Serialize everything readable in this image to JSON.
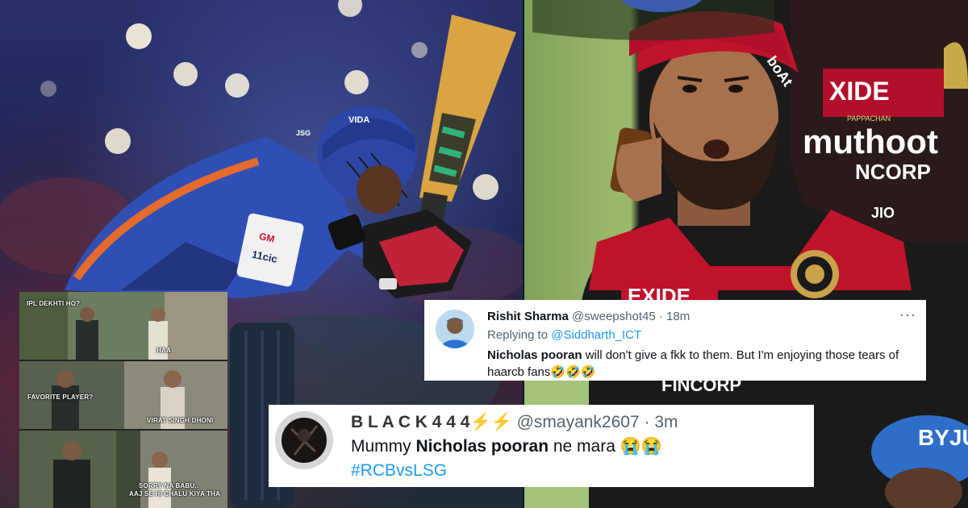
{
  "memes": [
    {
      "captions": [
        "IPL DEKHTI HO?",
        "HAA"
      ]
    },
    {
      "captions": [
        "FAVORITE PLAYER?",
        "VIRAT SINGH DHONI"
      ]
    },
    {
      "captions": [
        "SORRY NA BABU..",
        "AAJ SE HI CHALU KIYA THA"
      ]
    }
  ],
  "tweet_1": {
    "name": "Rishit Sharma",
    "handle": "@sweepshot45",
    "separator": "·",
    "time": "18m",
    "replying_prefix": "Replying to",
    "replying_to": "@Siddharth_ICT",
    "text_bold": "Nicholas pooran",
    "text_rest": " will don't give a fkk to them. But I'm enjoying those tears of haarcb fans🤣🤣🤣",
    "more": "···"
  },
  "tweet_2": {
    "name": "B L A C K 4 4 4",
    "name_emoji": "⚡⚡",
    "handle": "@smayank2607",
    "separator": "·",
    "time": "3m",
    "text_prefix": "Mummy ",
    "text_bold": "Nicholas pooran",
    "text_suffix": " ne mara 😭😭",
    "hashtag": "#RCBvsLSG"
  },
  "photo_text": {
    "left_helmet": "VIDA",
    "left_sponsor_1": "GM",
    "left_sponsor_2": "11cic",
    "left_helmet_badge": "JSG",
    "right_cap": "boAt",
    "right_exide": "XIDE",
    "right_muthoot": "muthoot",
    "right_pappachan": "PAPPACHAN",
    "right_fincorp": "NCORP",
    "right_exide_2": "EXIDE",
    "right_fincorp_2": "FINCORP",
    "right_cap_2": "JIO",
    "right_edge": "BYJU"
  }
}
